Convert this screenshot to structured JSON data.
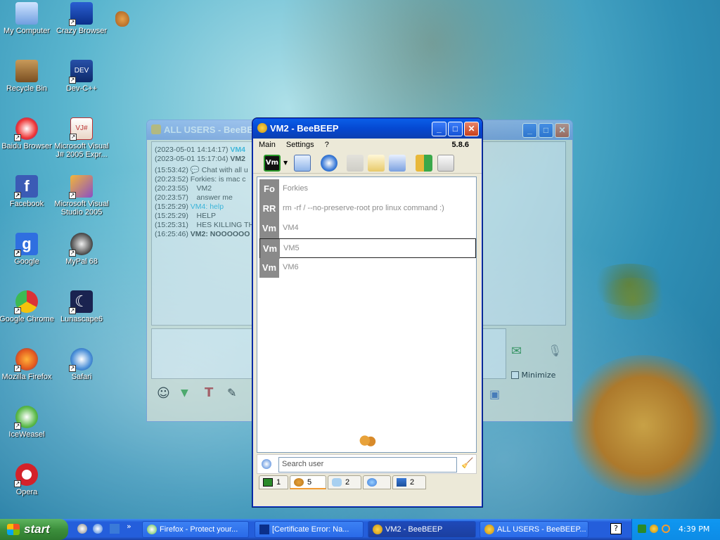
{
  "desktop": {
    "icons": [
      {
        "label": "My Computer"
      },
      {
        "label": "Crazy Browser"
      },
      {
        "label": "Recycle Bin"
      },
      {
        "label": "Dev-C++"
      },
      {
        "label": "Baidu Browser"
      },
      {
        "label": "Microsoft Visual J# 2005 Expr..."
      },
      {
        "label": "Facebook"
      },
      {
        "label": "Microsoft Visual Studio 2005"
      },
      {
        "label": "Google"
      },
      {
        "label": "MyPal 68"
      },
      {
        "label": "Google Chrome"
      },
      {
        "label": "Lunascape6"
      },
      {
        "label": "Mozilla Firefox"
      },
      {
        "label": "Safari"
      },
      {
        "label": "IceWeasel"
      },
      {
        "label": "Opera"
      }
    ]
  },
  "bg_window": {
    "title": "ALL USERS - BeeBEEP",
    "log": [
      {
        "ts": "(2023-05-01 14:14:17)",
        "text": "VM4"
      },
      {
        "ts": "(2023-05-01 15:17:04)",
        "text": "VM2"
      },
      {
        "ts": "(15:53:42)",
        "text": "Chat with all u"
      },
      {
        "ts": "(20:23:52)",
        "text": "Forkies: is mac c"
      },
      {
        "ts": "(20:23:55)",
        "text": "VM2"
      },
      {
        "ts": "(20:23:57)",
        "text": "answer me"
      },
      {
        "ts": "(15:25:29)",
        "text": "VM4: help"
      },
      {
        "ts": "(15:25:29)",
        "text": "HELP"
      },
      {
        "ts": "(15:25:31)",
        "text": "HES KILLING TH"
      },
      {
        "ts": "(16:25:46)",
        "text": "VM2: NOOOOOO"
      }
    ],
    "minimize_label": "Minimize"
  },
  "main_window": {
    "title": "VM2 - BeeBEEP",
    "version": "5.8.6",
    "menu": [
      "Main",
      "Settings",
      "?"
    ],
    "status_badge": "Vm",
    "users": [
      {
        "initials": "Fo",
        "text": "Forkies"
      },
      {
        "initials": "RR",
        "text": "rm -rf / --no-preserve-root pro linux command :)"
      },
      {
        "initials": "Vm",
        "text": "VM4"
      },
      {
        "initials": "Vm",
        "text": "VM5"
      },
      {
        "initials": "Vm",
        "text": "VM6"
      }
    ],
    "search_placeholder": "Search user",
    "tabs": [
      {
        "count": "1",
        "icon": "monitor-icon"
      },
      {
        "count": "5",
        "icon": "users-icon"
      },
      {
        "count": "2",
        "icon": "chat-icon"
      },
      {
        "count": "",
        "icon": "group-icon"
      },
      {
        "count": "2",
        "icon": "share-icon"
      }
    ]
  },
  "taskbar": {
    "start_label": "start",
    "tasks": [
      {
        "label": "Firefox - Protect your..."
      },
      {
        "label": "[Certificate Error: Na..."
      },
      {
        "label": "VM2 - BeeBEEP"
      },
      {
        "label": "ALL USERS - BeeBEEP..."
      }
    ],
    "clock": "4:39 PM"
  }
}
